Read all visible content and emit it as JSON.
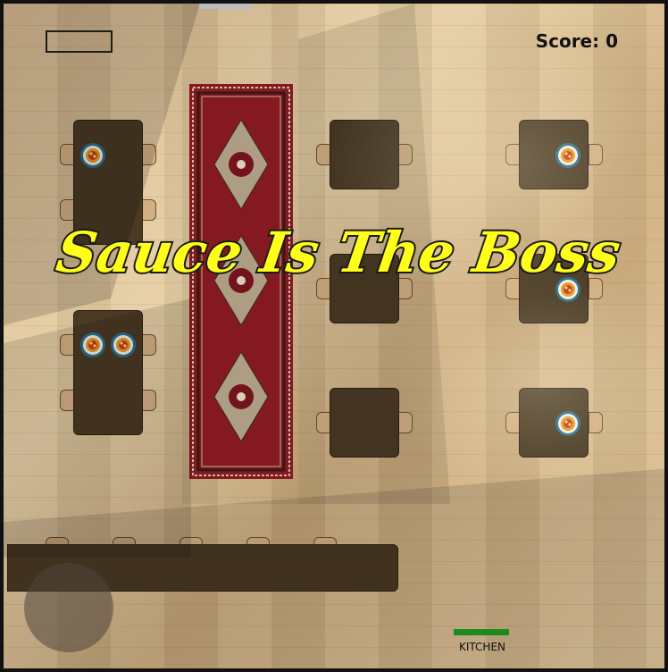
{
  "game": {
    "title": "Sauce Is The Boss",
    "score_label": "Score: 0",
    "kitchen_label": "KITCHEN"
  },
  "colors": {
    "title_fill": "#ffff1a",
    "title_outline": "#1a1a1a",
    "table": "#4a3a24",
    "chair": "#d3b083",
    "rug": "#8e1b25",
    "kitchen_progress": "#1e8a1e",
    "exit_door": "#e02020"
  },
  "icons": {
    "plate": "pizza-plate-icon",
    "rug": "persian-rug"
  }
}
